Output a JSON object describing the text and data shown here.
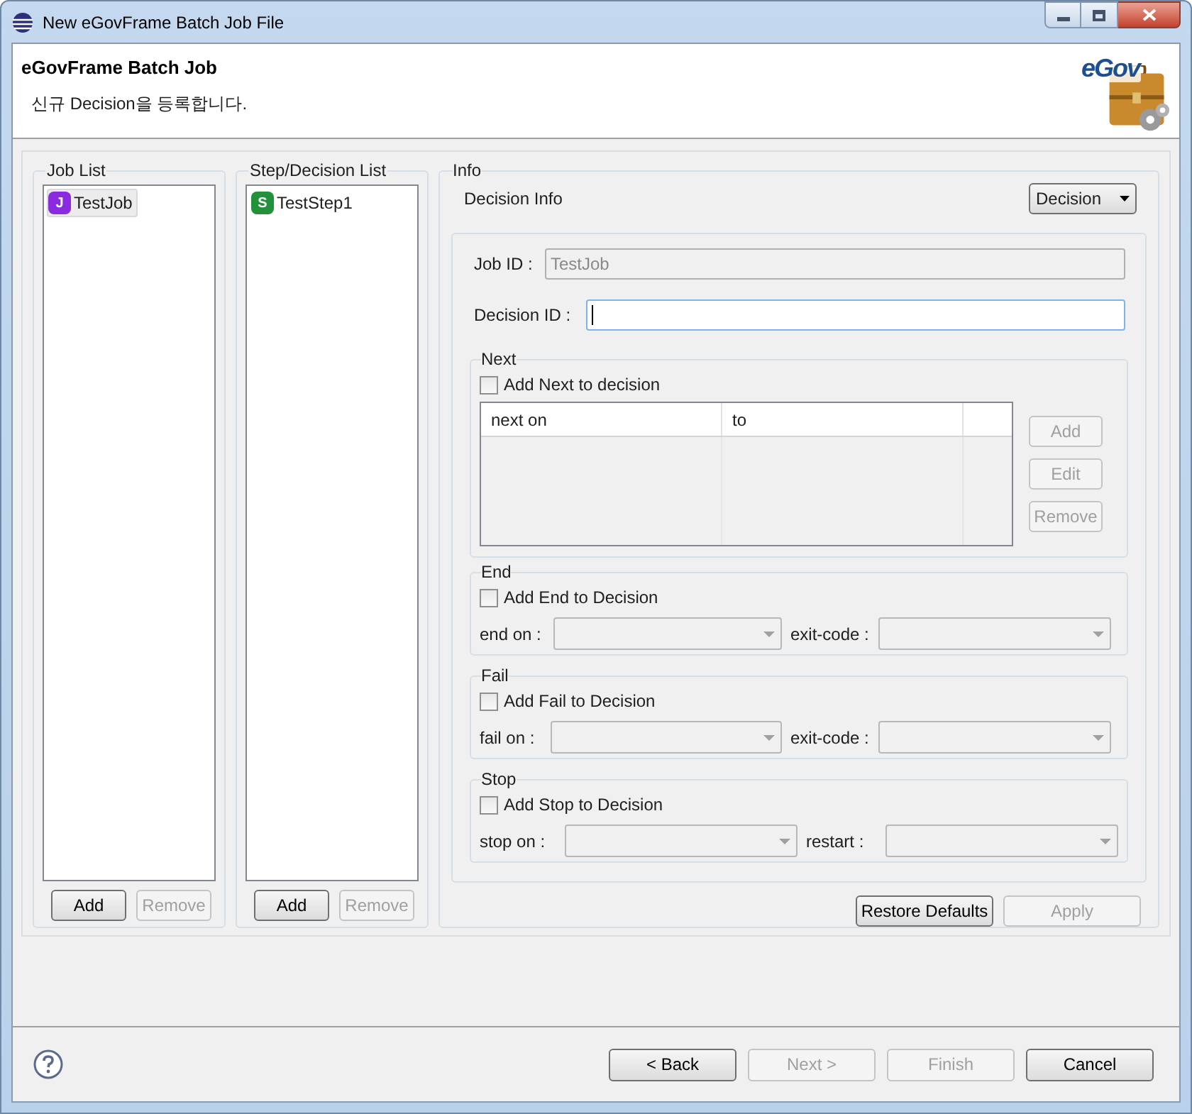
{
  "window": {
    "title": "New eGovFrame Batch Job File"
  },
  "header": {
    "title": "eGovFrame Batch Job",
    "description": "신규 Decision을 등록합니다.",
    "logo_text": "eGov"
  },
  "job_list": {
    "title": "Job List",
    "items": [
      {
        "label": "TestJob",
        "badge": "J",
        "color": "#8a2be2",
        "selected": true
      }
    ],
    "buttons": [
      {
        "label": "Add",
        "disabled": false
      },
      {
        "label": "Remove",
        "disabled": true
      }
    ]
  },
  "step_list": {
    "title": "Step/Decision List",
    "items": [
      {
        "label": "TestStep1",
        "badge": "S",
        "color": "#22913a",
        "selected": false
      }
    ],
    "buttons": [
      {
        "label": "Add",
        "disabled": false
      },
      {
        "label": "Remove",
        "disabled": true
      }
    ]
  },
  "info": {
    "title": "Info",
    "subtitle": "Decision Info",
    "type_dropdown": "Decision",
    "job_id": {
      "label": "Job ID :",
      "value": "TestJob",
      "disabled": true
    },
    "decision_id": {
      "label": "Decision ID :",
      "focused": true
    },
    "next": {
      "title": "Next",
      "checkbox": {
        "label": "Add Next to decision",
        "checked": false
      },
      "table": {
        "columns": [
          "next on",
          "to"
        ]
      },
      "buttons": [
        {
          "label": "Add",
          "disabled": true
        },
        {
          "label": "Edit",
          "disabled": true
        },
        {
          "label": "Remove",
          "disabled": true
        }
      ]
    },
    "sections": [
      {
        "title": "End",
        "checkbox": {
          "label": "Add End to Decision",
          "checked": false
        },
        "selects": [
          {
            "label": "end on :",
            "disabled": true
          },
          {
            "label": "exit-code :",
            "disabled": true
          }
        ]
      },
      {
        "title": "Fail",
        "checkbox": {
          "label": "Add Fail to Decision",
          "checked": false
        },
        "selects": [
          {
            "label": "fail on :",
            "disabled": true
          },
          {
            "label": "exit-code :",
            "disabled": true
          }
        ]
      },
      {
        "title": "Stop",
        "checkbox": {
          "label": "Add Stop to Decision",
          "checked": false
        },
        "selects": [
          {
            "label": "stop on :",
            "disabled": true
          },
          {
            "label": "restart :",
            "disabled": true
          }
        ]
      }
    ],
    "buttons": [
      {
        "label": "Restore Defaults",
        "disabled": false
      },
      {
        "label": "Apply",
        "disabled": true
      }
    ]
  },
  "wizard_buttons": [
    {
      "label": "< Back",
      "disabled": false
    },
    {
      "label": "Next >",
      "disabled": true
    },
    {
      "label": "Finish",
      "disabled": true
    },
    {
      "label": "Cancel",
      "disabled": false
    }
  ]
}
